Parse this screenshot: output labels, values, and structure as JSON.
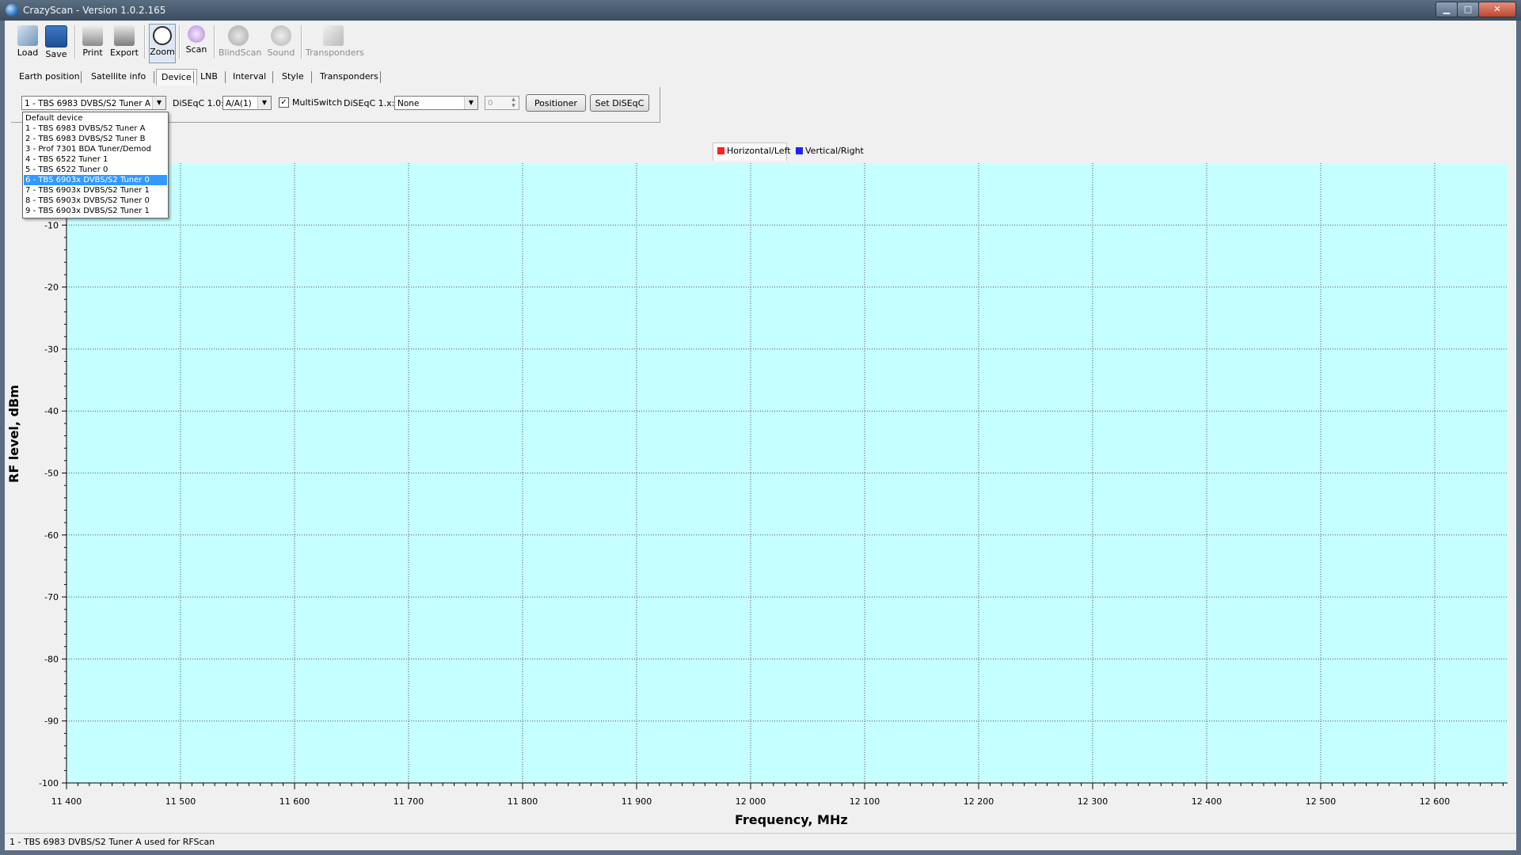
{
  "window": {
    "title": "CrazyScan - Version 1.0.2.165",
    "buttons": {
      "minimize": "▁",
      "maximize": "□",
      "close": "✕"
    }
  },
  "toolbar": {
    "load": "Load",
    "save": "Save",
    "print": "Print",
    "export": "Export",
    "zoom": "Zoom",
    "scan": "Scan",
    "blindscan": "BlindScan",
    "sound": "Sound",
    "transponders": "Transponders"
  },
  "tabs": {
    "earth_position": "Earth position",
    "satellite_info": "Satellite info",
    "device": "Device",
    "lnb": "LNB",
    "interval": "Interval",
    "style": "Style",
    "transponders": "Transponders"
  },
  "device_panel": {
    "device_value": "1 - TBS 6983 DVBS/S2 Tuner A",
    "diseqc10_label": "DiSEqC 1.0:",
    "diseqc10_value": "A/A(1)",
    "multiswitch_label": "MultiSwitch",
    "multiswitch_checked": "✓",
    "diseqc1x_label": "DiSEqC 1.x:",
    "diseqc1x_value": "None",
    "spin_value": "0",
    "positioner_button": "Positioner",
    "set_diseqc_button": "Set DiSEqC"
  },
  "device_dropdown": {
    "options": [
      "Default device",
      "1 - TBS 6983 DVBS/S2 Tuner A",
      "2 - TBS 6983 DVBS/S2 Tuner B",
      "3 - Prof 7301 BDA Tuner/Demod",
      "4 - TBS 6522 Tuner 1",
      "5 - TBS 6522 Tuner 0",
      "6 - TBS 6903x DVBS/S2 Tuner 0",
      "7 - TBS 6903x DVBS/S2 Tuner 1",
      "8 - TBS 6903x DVBS/S2 Tuner 0",
      "9 - TBS 6903x DVBS/S2 Tuner 1"
    ],
    "highlighted_index": 6
  },
  "chart_data": {
    "type": "line",
    "title": "",
    "xlabel": "Frequency, MHz",
    "ylabel": "RF level, dBm",
    "xlim": [
      11400,
      11650
    ],
    "ylim": [
      -100,
      0
    ],
    "x_ticks": [
      11400,
      11500,
      11600,
      11700,
      11800,
      11900,
      12000,
      12100,
      12200,
      12300,
      12400,
      12500,
      12600
    ],
    "x_tick_labels": [
      "11 400",
      "11 500",
      "11 600",
      "11 700",
      "11 800",
      "11 900",
      "12 000",
      "12 100",
      "12 200",
      "12 300",
      "12 400",
      "12 500",
      "12 600"
    ],
    "y_ticks": [
      -10,
      -20,
      -30,
      -40,
      -50,
      -60,
      -70,
      -80,
      -90,
      -100
    ],
    "y_tick_labels": [
      "-10",
      "-20",
      "-30",
      "-40",
      "-50",
      "-60",
      "-70",
      "-80",
      "-90",
      "-100"
    ],
    "series": [
      {
        "name": "Horizontal/Left",
        "color": "#ff2020",
        "values": []
      },
      {
        "name": "Vertical/Right",
        "color": "#2020ff",
        "values": []
      }
    ],
    "grid": true,
    "legend_position": "top-center",
    "plot_background": "#c6ffff"
  },
  "status": {
    "text": "1 - TBS 6983 DVBS/S2 Tuner A used for RFScan"
  },
  "colors": {
    "plot_background": "#c6ffff",
    "selection": "#3399ff",
    "titlebar": "#4a5c70"
  }
}
